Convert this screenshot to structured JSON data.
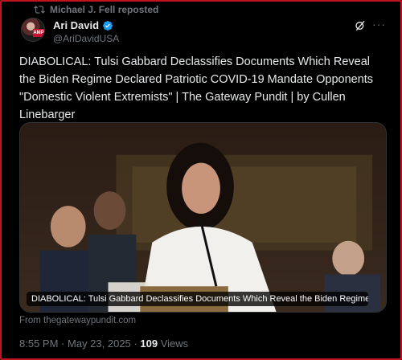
{
  "repost": {
    "text": "Michael J. Fell reposted",
    "icon": "repost-icon"
  },
  "author": {
    "name": "Ari David",
    "handle": "@AriDavidUSA",
    "avatar_badge": "AMP"
  },
  "post": {
    "text": "DIABOLICAL: Tulsi Gabbard Declassifies Documents Which Reveal the Biden Regime Declared Patriotic COVID-19 Mandate Opponents \"Domestic Violent Extremists\" | The Gateway Pundit | by Cullen Linebarger"
  },
  "link_card": {
    "caption": "DIABOLICAL: Tulsi Gabbard Declassifies Documents Which Reveal the Biden Regime ...",
    "source": "From thegatewaypundit.com"
  },
  "meta": {
    "time": "8:55 PM",
    "separator": "·",
    "date": "May 23, 2025",
    "views_count": "109",
    "views_label": "Views"
  },
  "colors": {
    "background": "#000000",
    "frame": "#c1121f",
    "verified": "#1d9bf0",
    "muted": "#71767b",
    "text": "#e7e9ea"
  }
}
